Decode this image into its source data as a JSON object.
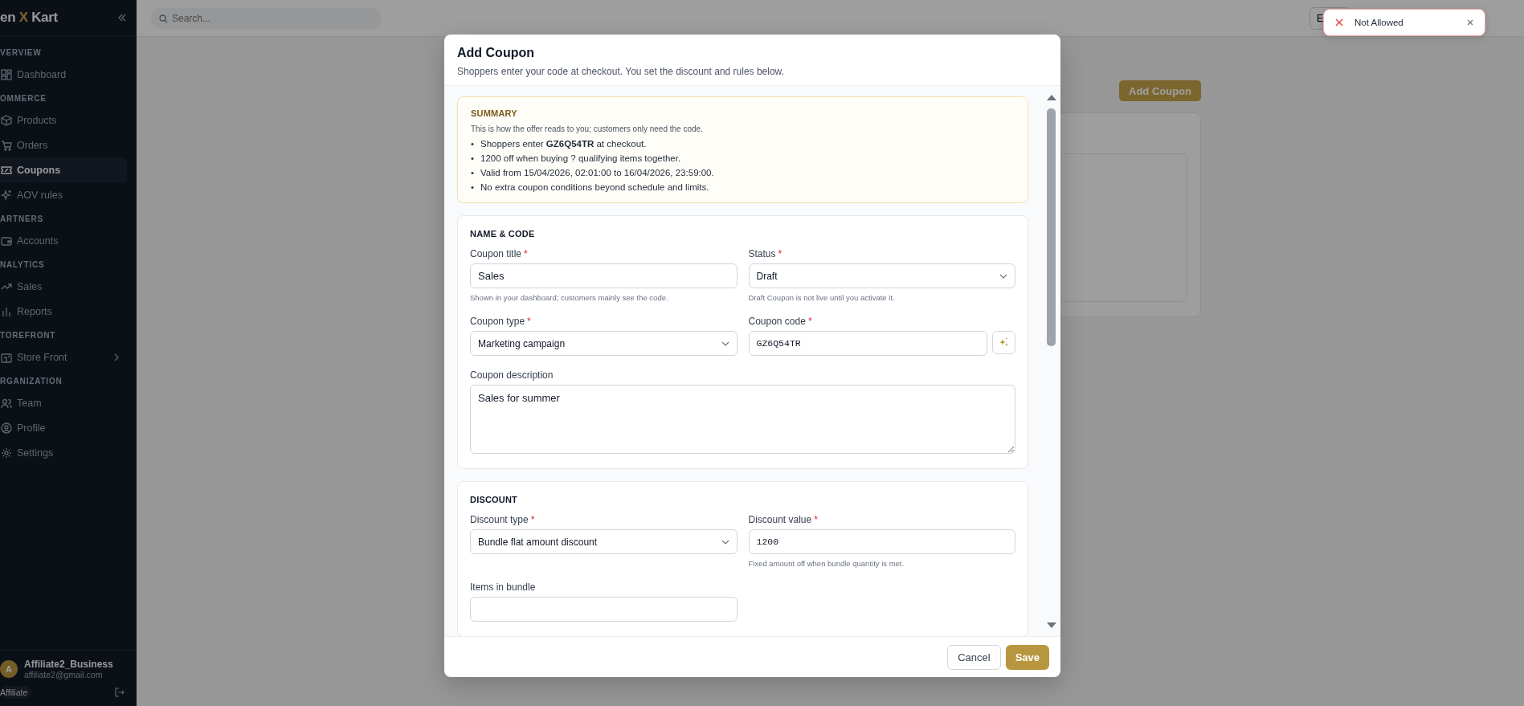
{
  "sidebar": {
    "logo": [
      "en",
      "X",
      "Kart"
    ],
    "groups": [
      {
        "heading": "VERVIEW",
        "items": [
          {
            "label": "Dashboard",
            "selected": false,
            "submenu": false
          }
        ]
      },
      {
        "heading": "OMMERCE",
        "items": [
          {
            "label": "Products",
            "selected": false,
            "submenu": false
          },
          {
            "label": "Orders",
            "selected": false,
            "submenu": false
          },
          {
            "label": "Coupons",
            "selected": true,
            "submenu": false
          },
          {
            "label": "AOV rules",
            "selected": false,
            "submenu": false
          }
        ]
      },
      {
        "heading": "ARTNERS",
        "items": [
          {
            "label": "Accounts",
            "selected": false,
            "submenu": false
          }
        ]
      },
      {
        "heading": "NALYTICS",
        "items": [
          {
            "label": "Sales",
            "selected": false,
            "submenu": false
          },
          {
            "label": "Reports",
            "selected": false,
            "submenu": false
          }
        ]
      },
      {
        "heading": "TOREFRONT",
        "items": [
          {
            "label": "Store Front",
            "selected": false,
            "submenu": true
          }
        ]
      },
      {
        "heading": "RGANIZATION",
        "items": [
          {
            "label": "Team",
            "selected": false,
            "submenu": false
          },
          {
            "label": "Profile",
            "selected": false,
            "submenu": false
          },
          {
            "label": "Settings",
            "selected": false,
            "submenu": false
          }
        ]
      }
    ],
    "user": {
      "initial": "A",
      "name": "Affiliate2_Business",
      "email": "affiliate2@gmail.com",
      "role": "Affiliate"
    }
  },
  "topbar": {
    "search": {
      "placeholder": "Search..."
    },
    "button": "E"
  },
  "page": {
    "add_button": "Add Coupon"
  },
  "toast": {
    "message": "Not Allowed"
  },
  "modal": {
    "title": "Add Coupon",
    "subtitle": "Shoppers enter your code at checkout. You set the discount and rules below.",
    "required_mark": "*",
    "summary": {
      "heading": "SUMMARY",
      "marker": "•",
      "intro": "This is how the offer reads to you; customers only need the code.",
      "bullets": [
        "Shoppers enter **GZ6Q54TR** at checkout.",
        "1200 off when buying ? qualifying items together.",
        "Valid from 15/04/2026, 02:01:00 to 16/04/2026, 23:59:00.",
        "No extra coupon conditions beyond schedule and limits."
      ]
    },
    "sections": [
      {
        "heading": "NAME & CODE",
        "fields": [
          {
            "kind": "text",
            "label": "Coupon title",
            "required": true,
            "value": "Sales",
            "hint": "Shown in your dashboard; customers mainly see the code."
          },
          {
            "kind": "select",
            "label": "Status",
            "required": true,
            "value": "Draft",
            "hint": "Draft Coupon is not live until you activate it."
          },
          {
            "kind": "select",
            "label": "Coupon type",
            "required": true,
            "value": "Marketing campaign"
          },
          {
            "kind": "code",
            "label": "Coupon code",
            "required": true,
            "value": "GZ6Q54TR"
          },
          {
            "kind": "textarea",
            "label": "Coupon description",
            "required": false,
            "value": "Sales for summer"
          }
        ]
      },
      {
        "heading": "DISCOUNT",
        "fields": [
          {
            "kind": "select",
            "label": "Discount type",
            "required": true,
            "value": "Bundle flat amount discount"
          },
          {
            "kind": "number",
            "label": "Discount value",
            "required": true,
            "value": "1200",
            "hint": "Fixed amount off when bundle quantity is met."
          },
          {
            "kind": "text",
            "label": "Items in bundle",
            "required": false
          }
        ]
      }
    ],
    "buttons": {
      "cancel": "Cancel",
      "save": "Save"
    }
  }
}
